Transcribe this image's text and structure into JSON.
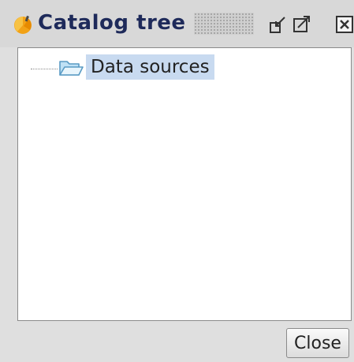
{
  "window": {
    "title": "Catalog tree",
    "icons": {
      "app": "catalog-app-icon",
      "undock": "undock-icon",
      "maximize": "maximize-icon",
      "close": "close-icon"
    }
  },
  "tree": {
    "nodes": [
      {
        "label": "Data sources",
        "icon": "folder-open-icon",
        "selected": true
      }
    ]
  },
  "footer": {
    "close_label": "Close"
  },
  "colors": {
    "selection": "#c8daf0",
    "title_text": "#1e2a5a",
    "app_icon": "#f2a216"
  }
}
